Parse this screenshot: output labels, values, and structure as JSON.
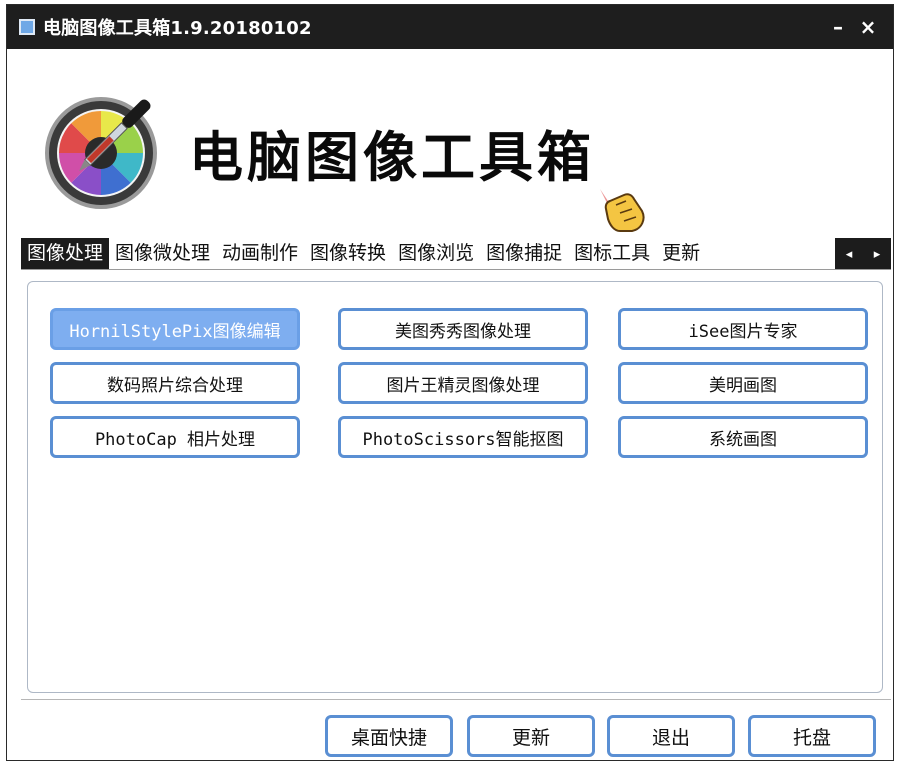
{
  "window": {
    "title": "电脑图像工具箱1.9.20180102",
    "min_label": "–",
    "close_label": "×"
  },
  "header": {
    "app_name": "电脑图像工具箱"
  },
  "tabs": [
    "图像处理",
    "图像微处理",
    "动画制作",
    "图像转换",
    "图像浏览",
    "图像捕捉",
    "图标工具",
    "更新"
  ],
  "active_tab": 0,
  "tab_arrows": [
    "◂",
    "▸"
  ],
  "tools": [
    [
      "HornilStylePix图像编辑",
      "美图秀秀图像处理",
      "iSee图片专家"
    ],
    [
      "数码照片综合处理",
      "图片王精灵图像处理",
      "美明画图"
    ],
    [
      "PhotoCap 相片处理",
      "PhotoScissors智能抠图",
      "系统画图"
    ]
  ],
  "bottom_buttons": [
    "桌面快捷",
    "更新",
    "退出",
    "托盘"
  ],
  "colors": {
    "button_border": "#5a8fd3",
    "selected_button": "#7eaef0",
    "titlebar": "#1e1e1e"
  }
}
